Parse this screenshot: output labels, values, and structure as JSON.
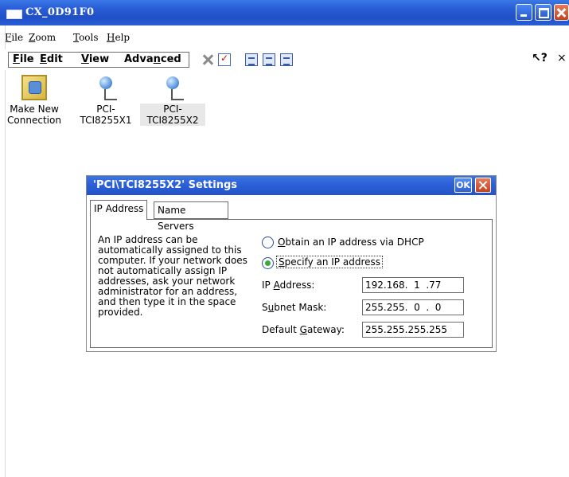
{
  "window": {
    "title": "CX_0D91F0"
  },
  "outer_menu": {
    "file": "File",
    "zoom": "Zoom",
    "tools": "Tools",
    "help": "Help"
  },
  "toolbar": {
    "file": "File",
    "edit": "Edit",
    "view": "View",
    "advanced": "Advanced",
    "help_icon_label": "?",
    "close_label": "×"
  },
  "icons": [
    {
      "label_line1": "Make New",
      "label_line2": "Connection",
      "icon": "connection-wizard-icon"
    },
    {
      "label_line1": "PCI-",
      "label_line2": "TCI8255X1",
      "icon": "network-adapter-icon"
    },
    {
      "label_line1": "PCI-",
      "label_line2": "TCI8255X2",
      "icon": "network-adapter-icon",
      "selected": true
    }
  ],
  "dialog": {
    "title": "'PCI\\TCI8255X2' Settings",
    "ok_label": "OK",
    "tabs": [
      "IP Address",
      "Name Servers"
    ],
    "active_tab": "IP Address",
    "description": "An IP address can be automatically assigned to this computer.  If your network does not automatically assign IP addresses, ask your network administrator for an address, and then type it in the space provided.",
    "options": {
      "dhcp": "Obtain an IP address via DHCP",
      "specify": "Specify an IP address",
      "selected": "specify"
    },
    "fields": {
      "ip_label": "IP Address:",
      "ip_value": "192.168.  1  .77",
      "subnet_label": "Subnet Mask:",
      "subnet_value": "255.255.  0  .  0",
      "gateway_label": "Default Gateway:",
      "gateway_value": "255.255.255.255"
    }
  },
  "colors": {
    "titlebar": "#2a5fd8",
    "close_button": "#c8401b",
    "radio_checked": "#3aaa3a"
  }
}
